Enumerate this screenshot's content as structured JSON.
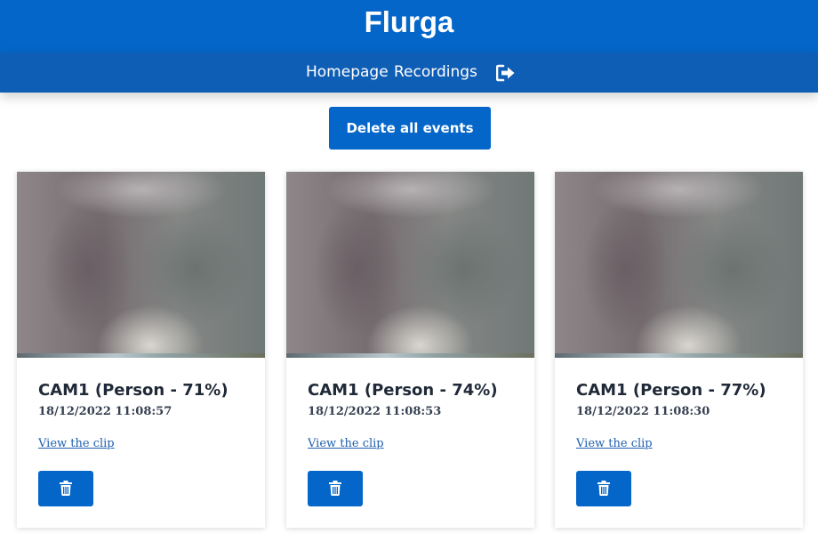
{
  "header": {
    "title": "Flurga"
  },
  "nav": {
    "items": [
      {
        "label": "Homepage"
      },
      {
        "label": "Recordings"
      }
    ],
    "logout_icon": "sign-out-icon"
  },
  "actions": {
    "delete_all_label": "Delete all events"
  },
  "colors": {
    "primary": "#0466c8",
    "nav_bar": "#0f5eb5",
    "link": "#1f5fae",
    "title_text": "#1f2937"
  },
  "events": [
    {
      "title": "CAM1 (Person - 71%)",
      "datetime": "18/12/2022 11:08:57",
      "link_label": "View the clip",
      "delete_icon": "trash-icon"
    },
    {
      "title": "CAM1 (Person - 74%)",
      "datetime": "18/12/2022 11:08:53",
      "link_label": "View the clip",
      "delete_icon": "trash-icon"
    },
    {
      "title": "CAM1 (Person - 77%)",
      "datetime": "18/12/2022 11:08:30",
      "link_label": "View the clip",
      "delete_icon": "trash-icon"
    }
  ]
}
